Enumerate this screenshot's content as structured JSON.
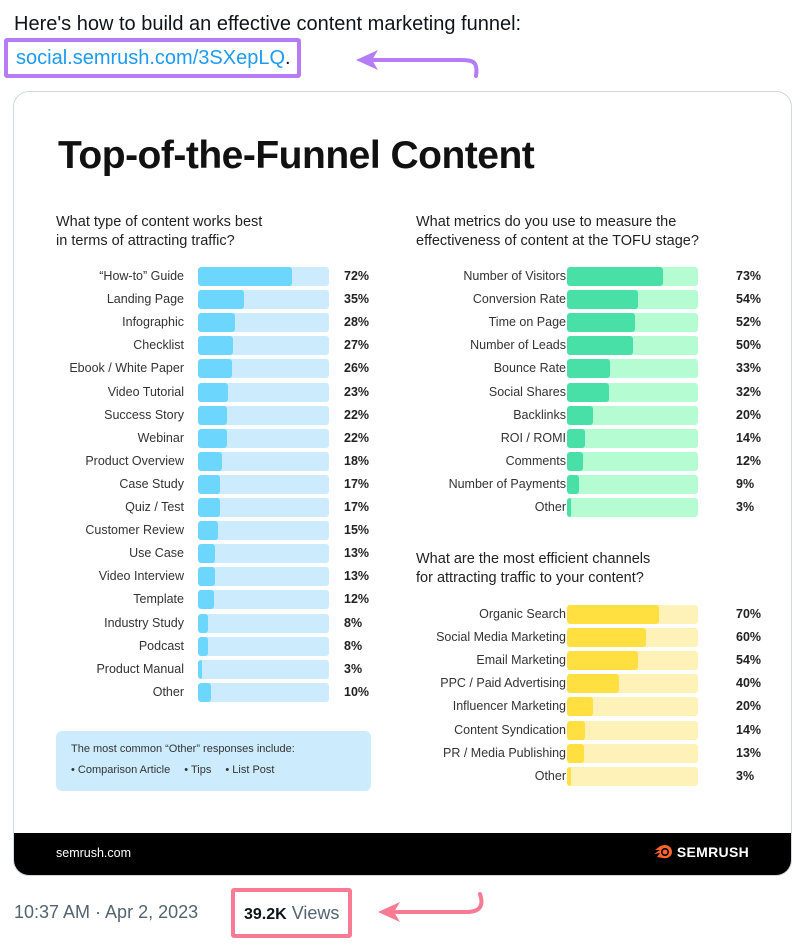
{
  "tweet": {
    "text": "Here's how to build an effective content marketing funnel:",
    "link": "social.semrush.com/3SXepLQ",
    "link_suffix": ".",
    "timestamp": "10:37 AM · Apr 2, 2023",
    "views_count": "39.2K",
    "views_label": "Views"
  },
  "annotation_colors": {
    "link_highlight": "#b57cf5",
    "views_highlight": "#f97a93"
  },
  "infographic": {
    "title": "Top-of-the-Funnel Content",
    "note": {
      "title": "The most common “Other” responses include:",
      "items": [
        "Comparison Article",
        "Tips",
        "List Post"
      ]
    },
    "footer_site": "semrush.com",
    "footer_brand": "SEMRUSH"
  },
  "chart_data": [
    {
      "type": "bar",
      "orientation": "horizontal",
      "title": "What type of content works best in terms of attracting traffic?",
      "title_lines": [
        "What type of content works best",
        "in terms of attracting traffic?"
      ],
      "unit": "%",
      "xlim": [
        0,
        100
      ],
      "colors": {
        "fill": "#6dd6fd",
        "track": "#ccecfd"
      },
      "categories": [
        "“How-to” Guide",
        "Landing Page",
        "Infographic",
        "Checklist",
        "Ebook / White Paper",
        "Video Tutorial",
        "Success Story",
        "Webinar",
        "Product Overview",
        "Case Study",
        "Quiz / Test",
        "Customer Review",
        "Use Case",
        "Video Interview",
        "Template",
        "Industry Study",
        "Podcast",
        "Product Manual",
        "Other"
      ],
      "values": [
        72,
        35,
        28,
        27,
        26,
        23,
        22,
        22,
        18,
        17,
        17,
        15,
        13,
        13,
        12,
        8,
        8,
        3,
        10
      ]
    },
    {
      "type": "bar",
      "orientation": "horizontal",
      "title": "What metrics do you use to measure the effectiveness of content at the TOFU stage?",
      "title_lines": [
        "What metrics do you use to measure the",
        "effectiveness of content at the TOFU stage?"
      ],
      "unit": "%",
      "xlim": [
        0,
        100
      ],
      "colors": {
        "fill": "#48e0a7",
        "track": "#b6fcd3"
      },
      "categories": [
        "Number of Visitors",
        "Conversion Rate",
        "Time on Page",
        "Number of Leads",
        "Bounce Rate",
        "Social Shares",
        "Backlinks",
        "ROI / ROMI",
        "Comments",
        "Number of Payments",
        "Other"
      ],
      "values": [
        73,
        54,
        52,
        50,
        33,
        32,
        20,
        14,
        12,
        9,
        3
      ]
    },
    {
      "type": "bar",
      "orientation": "horizontal",
      "title": "What are the most efficient channels for attracting traffic to your content?",
      "title_lines": [
        "What are the most efficient channels",
        "for attracting traffic to your content?"
      ],
      "unit": "%",
      "xlim": [
        0,
        100
      ],
      "colors": {
        "fill": "#ffe040",
        "track": "#fff2b8"
      },
      "categories": [
        "Organic Search",
        "Social Media Marketing",
        "Email Marketing",
        "PPC / Paid Advertising",
        "Influencer Marketing",
        "Content Syndication",
        "PR / Media Publishing",
        "Other"
      ],
      "values": [
        70,
        60,
        54,
        40,
        20,
        14,
        13,
        3
      ]
    }
  ]
}
